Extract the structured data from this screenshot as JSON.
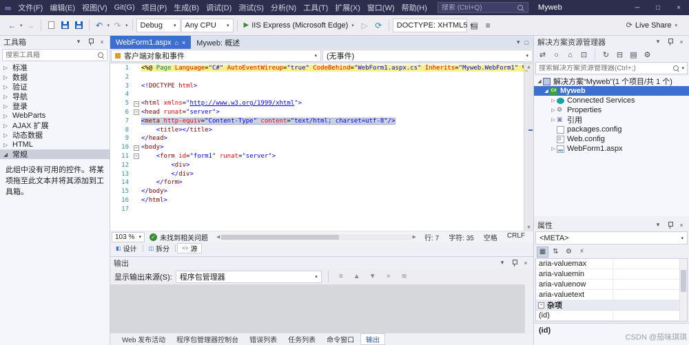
{
  "titlebar": {
    "menus": [
      "文件(F)",
      "编辑(E)",
      "视图(V)",
      "Git(G)",
      "项目(P)",
      "生成(B)",
      "调试(D)",
      "测试(S)",
      "分析(N)",
      "工具(T)",
      "扩展(X)",
      "窗口(W)",
      "帮助(H)"
    ],
    "search_placeholder": "搜索 (Ctrl+Q)",
    "app_title": "Myweb"
  },
  "toolbar": {
    "debug": "Debug",
    "platform": "Any CPU",
    "run": "IIS Express (Microsoft Edge)",
    "doctype": "DOCTYPE: XHTML5",
    "live_share": "Live Share"
  },
  "toolbox": {
    "title": "工具箱",
    "search_placeholder": "搜索工具箱",
    "items": [
      {
        "label": "标准"
      },
      {
        "label": "数据"
      },
      {
        "label": "验证"
      },
      {
        "label": "导航"
      },
      {
        "label": "登录"
      },
      {
        "label": "WebParts"
      },
      {
        "label": "AJAX 扩展"
      },
      {
        "label": "动态数据"
      },
      {
        "label": "HTML"
      },
      {
        "label": "常规",
        "expanded": true,
        "selected": true
      }
    ],
    "empty_text": "此组中没有可用的控件。将某项拖至此文本并将其添加到工具箱。"
  },
  "editor": {
    "tabs": [
      {
        "label": "WebForm1.aspx",
        "active": true
      },
      {
        "label": "Myweb: 概述",
        "active": false
      }
    ],
    "nav_left": "客户端对象和事件",
    "nav_right": "(无事件)",
    "zoom": "103 %",
    "health": "未找到相关问题",
    "pos_line": "行: 7",
    "pos_char": "字符: 35",
    "pos_space": "空格",
    "pos_eol": "CRLF",
    "views": [
      "设计",
      "拆分",
      "源"
    ],
    "views_active": 2,
    "lines": [
      {
        "n": 1,
        "i": 0,
        "bg": "y",
        "s": [
          [
            "p",
            "<%@ "
          ],
          [
            "r",
            "Page"
          ],
          [
            "p",
            " "
          ],
          [
            "a",
            "Language"
          ],
          [
            "p",
            "="
          ],
          [
            "v",
            "\"C#\""
          ],
          [
            "p",
            " "
          ],
          [
            "a",
            "AutoEventWireup"
          ],
          [
            "p",
            "="
          ],
          [
            "v",
            "\"true\""
          ],
          [
            "p",
            " "
          ],
          [
            "a",
            "CodeBehind"
          ],
          [
            "p",
            "="
          ],
          [
            "v",
            "\"WebForm1.aspx.cs\""
          ],
          [
            "p",
            " "
          ],
          [
            "a",
            "Inherits"
          ],
          [
            "p",
            "="
          ],
          [
            "v",
            "\"Myweb.WebForm1\""
          ],
          [
            "p",
            " %"
          ]
        ]
      },
      {
        "n": 2,
        "i": 0,
        "s": []
      },
      {
        "n": 3,
        "i": 0,
        "s": [
          [
            "d",
            "<!"
          ],
          [
            "t",
            "DOCTYPE"
          ],
          [
            "p",
            " "
          ],
          [
            "a",
            "html"
          ],
          [
            "d",
            ">"
          ]
        ]
      },
      {
        "n": 4,
        "i": 0,
        "s": []
      },
      {
        "n": 5,
        "i": 0,
        "f": true,
        "s": [
          [
            "d",
            "<"
          ],
          [
            "t",
            "html"
          ],
          [
            "p",
            " "
          ],
          [
            "a",
            "xmlns"
          ],
          [
            "p",
            "="
          ],
          [
            "v",
            "\""
          ],
          [
            "u",
            "http://www.w3.org/1999/xhtml"
          ],
          [
            "v",
            "\""
          ],
          [
            "d",
            ">"
          ]
        ]
      },
      {
        "n": 6,
        "i": 0,
        "f": true,
        "s": [
          [
            "d",
            "<"
          ],
          [
            "t",
            "head"
          ],
          [
            "p",
            " "
          ],
          [
            "a",
            "runat"
          ],
          [
            "p",
            "="
          ],
          [
            "v",
            "\"server\""
          ],
          [
            "d",
            ">"
          ]
        ]
      },
      {
        "n": 7,
        "i": 0,
        "bg": "sel",
        "s": [
          [
            "d",
            "<"
          ],
          [
            "t",
            "meta"
          ],
          [
            "p",
            " "
          ],
          [
            "a",
            "http-equiv"
          ],
          [
            "p",
            "="
          ],
          [
            "v",
            "\"Content-Type\""
          ],
          [
            "p",
            " "
          ],
          [
            "a",
            "content"
          ],
          [
            "p",
            "="
          ],
          [
            "v",
            "\"text/html; charset=utf-8\""
          ],
          [
            "d",
            "/>"
          ]
        ]
      },
      {
        "n": 8,
        "i": 1,
        "s": [
          [
            "d",
            "<"
          ],
          [
            "t",
            "title"
          ],
          [
            "d",
            "></"
          ],
          [
            "t",
            "title"
          ],
          [
            "d",
            ">"
          ]
        ]
      },
      {
        "n": 9,
        "i": 0,
        "s": [
          [
            "d",
            "</"
          ],
          [
            "t",
            "head"
          ],
          [
            "d",
            ">"
          ]
        ]
      },
      {
        "n": 10,
        "i": 0,
        "f": true,
        "s": [
          [
            "d",
            "<"
          ],
          [
            "t",
            "body"
          ],
          [
            "d",
            ">"
          ]
        ]
      },
      {
        "n": 11,
        "i": 1,
        "f": true,
        "s": [
          [
            "d",
            "<"
          ],
          [
            "t",
            "form"
          ],
          [
            "p",
            " "
          ],
          [
            "a",
            "id"
          ],
          [
            "p",
            "="
          ],
          [
            "v",
            "\"form1\""
          ],
          [
            "p",
            " "
          ],
          [
            "a",
            "runat"
          ],
          [
            "p",
            "="
          ],
          [
            "v",
            "\"server\""
          ],
          [
            "d",
            ">"
          ]
        ]
      },
      {
        "n": 12,
        "i": 2,
        "s": [
          [
            "d",
            "<"
          ],
          [
            "t",
            "div"
          ],
          [
            "d",
            ">"
          ]
        ]
      },
      {
        "n": 13,
        "i": 2,
        "s": [
          [
            "d",
            "</"
          ],
          [
            "t",
            "div"
          ],
          [
            "d",
            ">"
          ]
        ]
      },
      {
        "n": 14,
        "i": 1,
        "s": [
          [
            "d",
            "</"
          ],
          [
            "t",
            "form"
          ],
          [
            "d",
            ">"
          ]
        ]
      },
      {
        "n": 15,
        "i": 0,
        "s": [
          [
            "d",
            "</"
          ],
          [
            "t",
            "body"
          ],
          [
            "d",
            ">"
          ]
        ]
      },
      {
        "n": 16,
        "i": 0,
        "s": [
          [
            "d",
            "</"
          ],
          [
            "t",
            "html"
          ],
          [
            "d",
            ">"
          ]
        ]
      },
      {
        "n": 17,
        "i": 0,
        "s": []
      }
    ]
  },
  "output": {
    "title": "输出",
    "source_label": "显示输出来源(S):",
    "source_value": "程序包管理器"
  },
  "bottom_tabs": [
    "Web 发布活动",
    "程序包管理器控制台",
    "错误列表",
    "任务列表",
    "命令窗口",
    "输出"
  ],
  "bottom_tabs_active": 5,
  "solution": {
    "title": "解决方案资源管理器",
    "search_placeholder": "搜索解决方案资源管理器(Ctrl+;)",
    "tree": [
      {
        "label": "解决方案“Myweb”(1 个项目/共 1 个)",
        "icon": "solution",
        "indent": 0,
        "exp": "open"
      },
      {
        "label": "Myweb",
        "icon": "project",
        "indent": 1,
        "exp": "open",
        "selected": true,
        "bold": true
      },
      {
        "label": "Connected Services",
        "icon": "services",
        "indent": 2,
        "exp": "closed"
      },
      {
        "label": "Properties",
        "icon": "properties",
        "indent": 2,
        "exp": "closed"
      },
      {
        "label": "引用",
        "icon": "references",
        "indent": 2,
        "exp": "closed"
      },
      {
        "label": "packages.config",
        "icon": "file",
        "indent": 2,
        "exp": "none"
      },
      {
        "label": "Web.config",
        "icon": "config",
        "indent": 2,
        "exp": "none"
      },
      {
        "label": "WebForm1.aspx",
        "icon": "aspx",
        "indent": 2,
        "exp": "closed"
      }
    ]
  },
  "properties": {
    "title": "属性",
    "selector": "<META>",
    "rows": [
      "aria-valuemax",
      "aria-valuemin",
      "aria-valuenow",
      "aria-valuetext"
    ],
    "category": "杂项",
    "id_row": "(id)",
    "description_title": "(id)"
  },
  "watermark": "CSDN @茄味琪琪",
  "icons": {
    "infinity": "∞",
    "chevron_down": "▾",
    "close": "×",
    "minimize": "─",
    "maximize": "□",
    "home": "⌂",
    "back": "←",
    "forward": "→",
    "undo": "↶",
    "redo": "↷",
    "play": "▶",
    "play_outline": "▷",
    "refresh": "⟳",
    "refresh2": "↻",
    "expanded": "◢",
    "collapsed": "▷",
    "check": "✓",
    "left": "◀",
    "right": "▶",
    "up": "▲",
    "down": "▼",
    "minus": "−",
    "gear": "⚙",
    "lightning": "⚡",
    "categorized": "▦",
    "sort_alpha": "⇅",
    "list": "≡",
    "wrap": "≋",
    "collapse_all": "⊟",
    "show_all": "▤",
    "sync": "⇄",
    "circle": "○",
    "pane": "⊡",
    "design": "◧",
    "split": "◫",
    "source": "<>"
  }
}
